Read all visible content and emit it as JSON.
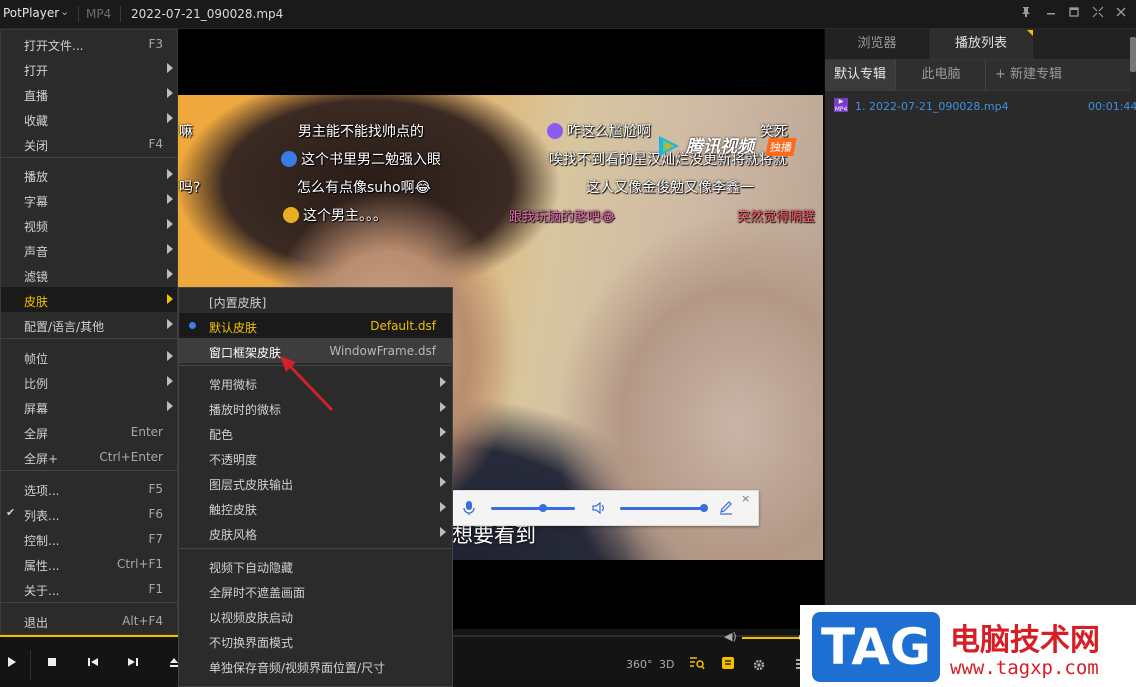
{
  "titlebar": {
    "app_name": "PotPlayer",
    "format": "MP4",
    "file_title": "2022-07-21_090028.mp4",
    "buttons": [
      "pin-icon",
      "minimize-icon",
      "maximize-icon",
      "fullscreen-icon",
      "close-icon"
    ]
  },
  "video": {
    "danmaku": [
      "男主能不能找帅点的",
      "咋这么尴尬啊",
      "笑死",
      "这个书里男二勉强入眼",
      "唉找不到看的星汉灿烂没更新将就将就",
      "怎么有点像suho啊😂",
      "这人又像金俊勉又像李鑫一",
      "这个男主。。。",
      "跟我玩脑的憨吧😂",
      "突然觉得隔壁",
      "嘛",
      "吗?"
    ],
    "logo_text": "腾讯视频",
    "logo_badge": "独播",
    "subtitle": "想要看到"
  },
  "main_menu": {
    "items": [
      {
        "label": "打开文件...",
        "shortcut": "F3",
        "submenu": false
      },
      {
        "label": "打开",
        "shortcut": "",
        "submenu": true
      },
      {
        "label": "直播",
        "shortcut": "",
        "submenu": true
      },
      {
        "label": "收藏",
        "shortcut": "",
        "submenu": true
      },
      {
        "label": "关闭",
        "shortcut": "F4",
        "submenu": false
      },
      {
        "label": "播放",
        "shortcut": "",
        "submenu": true
      },
      {
        "label": "字幕",
        "shortcut": "",
        "submenu": true
      },
      {
        "label": "视频",
        "shortcut": "",
        "submenu": true
      },
      {
        "label": "声音",
        "shortcut": "",
        "submenu": true
      },
      {
        "label": "滤镜",
        "shortcut": "",
        "submenu": true
      },
      {
        "label": "皮肤",
        "shortcut": "",
        "submenu": true
      },
      {
        "label": "配置/语言/其他",
        "shortcut": "",
        "submenu": true
      },
      {
        "label": "帧位",
        "shortcut": "",
        "submenu": true
      },
      {
        "label": "比例",
        "shortcut": "",
        "submenu": true
      },
      {
        "label": "屏幕",
        "shortcut": "",
        "submenu": true
      },
      {
        "label": "全屏",
        "shortcut": "Enter",
        "submenu": false
      },
      {
        "label": "全屏+",
        "shortcut": "Ctrl+Enter",
        "submenu": false
      },
      {
        "label": "选项...",
        "shortcut": "F5",
        "submenu": false
      },
      {
        "label": "列表...",
        "shortcut": "F6",
        "submenu": false
      },
      {
        "label": "控制...",
        "shortcut": "F7",
        "submenu": false
      },
      {
        "label": "属性...",
        "shortcut": "Ctrl+F1",
        "submenu": false
      },
      {
        "label": "关于...",
        "shortcut": "F1",
        "submenu": false
      },
      {
        "label": "退出",
        "shortcut": "Alt+F4",
        "submenu": false
      }
    ]
  },
  "skin_menu": {
    "header": "[内置皮肤]",
    "items": [
      {
        "label": "默认皮肤",
        "value": "Default.dsf"
      },
      {
        "label": "窗口框架皮肤",
        "value": "WindowFrame.dsf"
      },
      {
        "label": "常用微标",
        "value": ""
      },
      {
        "label": "播放时的微标",
        "value": ""
      },
      {
        "label": "配色",
        "value": ""
      },
      {
        "label": "不透明度",
        "value": ""
      },
      {
        "label": "图层式皮肤输出",
        "value": ""
      },
      {
        "label": "触控皮肤",
        "value": ""
      },
      {
        "label": "皮肤风格",
        "value": ""
      },
      {
        "label": "视频下自动隐藏",
        "value": ""
      },
      {
        "label": "全屏时不遮盖画面",
        "value": ""
      },
      {
        "label": "以视频皮肤启动",
        "value": ""
      },
      {
        "label": "不切换界面模式",
        "value": ""
      },
      {
        "label": "单独保存音频/视频界面位置/尺寸",
        "value": ""
      }
    ]
  },
  "playlist": {
    "tabs": [
      "浏览器",
      "播放列表"
    ],
    "subtabs": [
      "默认专辑",
      "此电脑",
      "+ 新建专辑"
    ],
    "items": [
      {
        "name": "1. 2022-07-21_090028.mp4",
        "duration": "00:01:44"
      }
    ]
  },
  "controls": {
    "btn_360": "360°",
    "btn_3d": "3D"
  },
  "watermark": {
    "tag": "TAG",
    "name": "电脑技术网",
    "url": "www.tagxp.com"
  },
  "colors": {
    "accent": "#f0c000",
    "selection_dot": "#3f7fe8",
    "arrow": "#d0202a",
    "watermark_blue": "#1d6fd1",
    "watermark_red": "#d81e24"
  }
}
